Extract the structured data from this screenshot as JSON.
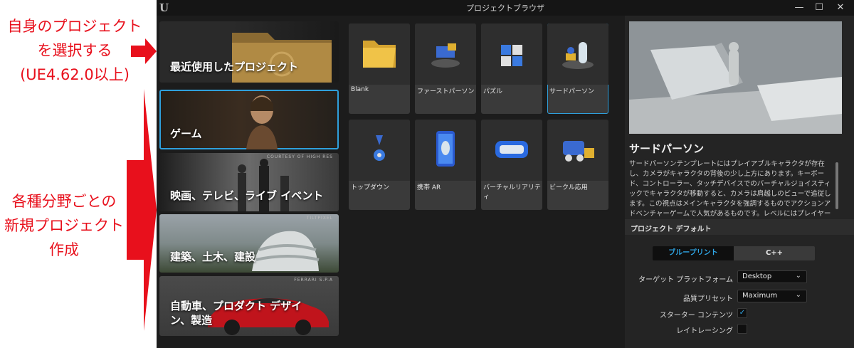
{
  "annotations": {
    "top": "自身のプロジェクト\nを選択する\n(UE4.62.0以上)",
    "bottom": "各種分野ごとの\n新規プロジェクト\n作成"
  },
  "window": {
    "title": "プロジェクトブラウザ",
    "logo": "U",
    "minimize": "—",
    "maximize": "☐",
    "close": "✕"
  },
  "categories": [
    {
      "label": "最近使用したプロジェクト",
      "credit": ""
    },
    {
      "label": "ゲーム",
      "credit": ""
    },
    {
      "label": "映画、テレビ、ライブ イベント",
      "credit": "COURTESY OF HIGH RES"
    },
    {
      "label": "建築、土木、建設",
      "credit": "TILTPIXEL"
    },
    {
      "label": "自動車、プロダクト デザイン、製造",
      "credit": "FERRARI S.P.A"
    }
  ],
  "templates": [
    {
      "label": "Blank",
      "icon": "folder-icon"
    },
    {
      "label": "ファーストパーソン",
      "icon": "first-person-icon"
    },
    {
      "label": "パズル",
      "icon": "puzzle-icon"
    },
    {
      "label": "サードパーソン",
      "icon": "third-person-icon"
    },
    {
      "label": "トップダウン",
      "icon": "top-down-icon"
    },
    {
      "label": "携帯 AR",
      "icon": "handheld-ar-icon"
    },
    {
      "label": "バーチャルリアリティ",
      "icon": "vr-headset-icon"
    },
    {
      "label": "ビークル応用",
      "icon": "vehicle-icon"
    }
  ],
  "details": {
    "title": "サードパーソン",
    "description": "サードパーソンテンプレートにはプレイアブルキャラクタが存在し、カメラがキャラクタの背後の少し上方にあります。キーボード、コントローラー、タッチデバイスでのバーチャルジョイスティックでキャラクタが移動すると、カメラは肩越しのビューで追従します。この視点はメインキャラクタを強調するものでアクションアドベンチャーゲームで人気があるものです。レベルにはプレイヤーがジャンプして乗ることができるオブジェクトが置かれています。",
    "section_title": "プロジェクト デフォルト",
    "toggle_blueprint": "ブループリント",
    "toggle_cpp": "C++",
    "target_platform_label": "ターゲット プラットフォーム",
    "target_platform_value": "Desktop",
    "quality_label": "品質プリセット",
    "quality_value": "Maximum",
    "starter_content_label": "スターター コンテンツ",
    "starter_content_check": "✓",
    "raytracing_label": "レイトレーシング",
    "chevron": "⌄"
  },
  "colors": {
    "annotation_red": "#e8101c",
    "accent_blue": "#2fa0dc"
  }
}
